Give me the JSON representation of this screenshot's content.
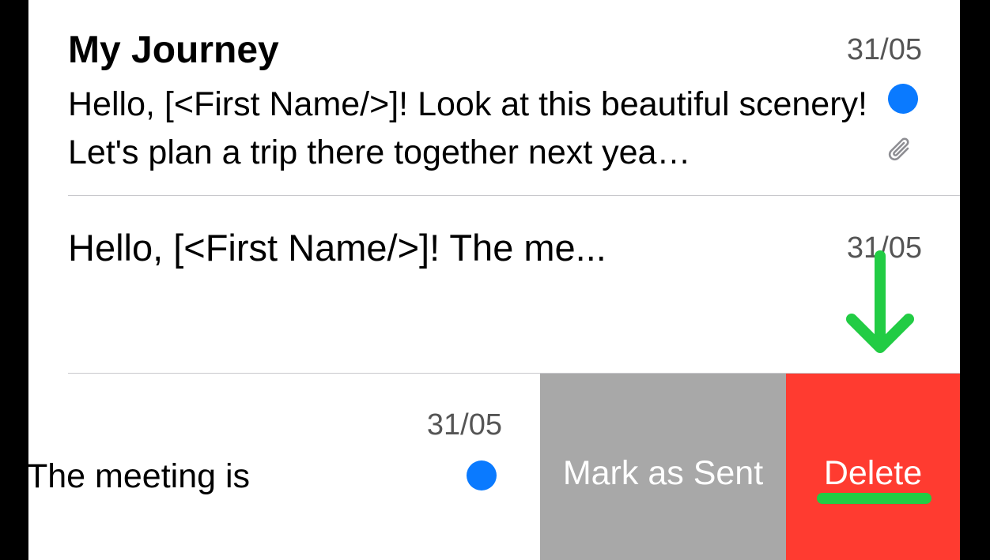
{
  "messages": [
    {
      "title": "My Journey",
      "date": "31/05",
      "preview": "Hello, [<First Name/>]! Look at this beautiful scenery! Let's plan a trip there together next yea…",
      "unread": true,
      "has_attachment": true,
      "attachment_icon": "paperclip-icon"
    },
    {
      "preview": "Hello, [<First Name/>]! The me...",
      "date": "31/05"
    },
    {
      "preview": "The meeting is",
      "date": "31/05",
      "unread": true
    }
  ],
  "swipe_actions": {
    "mark_as_sent": "Mark as Sent",
    "delete": "Delete"
  },
  "colors": {
    "unread_dot": "#0a7aff",
    "mark_bg": "#a8a8a8",
    "delete_bg": "#ff3b30",
    "annotation": "#22cc44"
  },
  "annotation": {
    "icon": "down-arrow-icon"
  }
}
